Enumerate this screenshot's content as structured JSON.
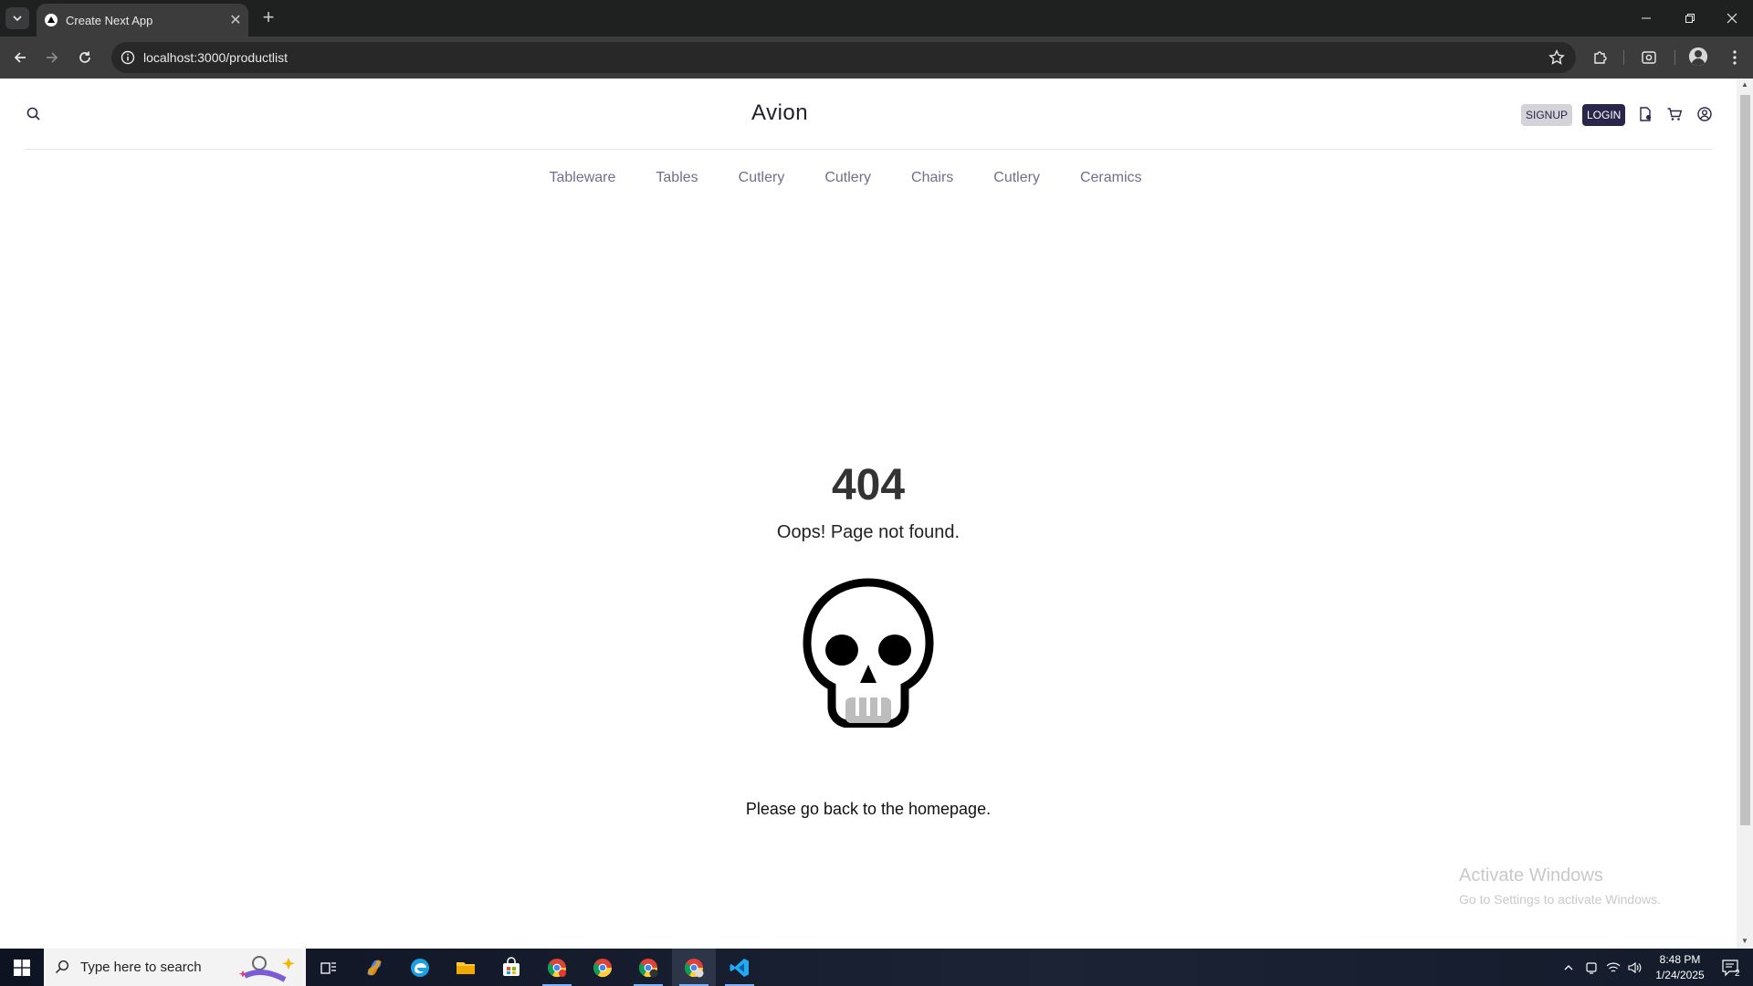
{
  "browser": {
    "tab_title": "Create Next App",
    "url": "localhost:3000/productlist"
  },
  "header": {
    "brand": "Avion",
    "signup_label": "SIGNUP",
    "login_label": "LOGIN"
  },
  "categories": [
    "Tableware",
    "Tables",
    "Cutlery",
    "Cutlery",
    "Chairs",
    "Cutlery",
    "Ceramics"
  ],
  "not_found": {
    "code": "404",
    "message": "Oops! Page not found.",
    "home_message": "Please go back to the homepage."
  },
  "watermark": {
    "title": "Activate Windows",
    "subtitle": "Go to Settings to activate Windows."
  },
  "taskbar": {
    "search_placeholder": "Type here to search",
    "time": "8:48 PM",
    "date": "1/24/2025",
    "notification_count": "2"
  },
  "colors": {
    "brand_dark": "#2a254b",
    "nav_text": "#726e8d"
  }
}
